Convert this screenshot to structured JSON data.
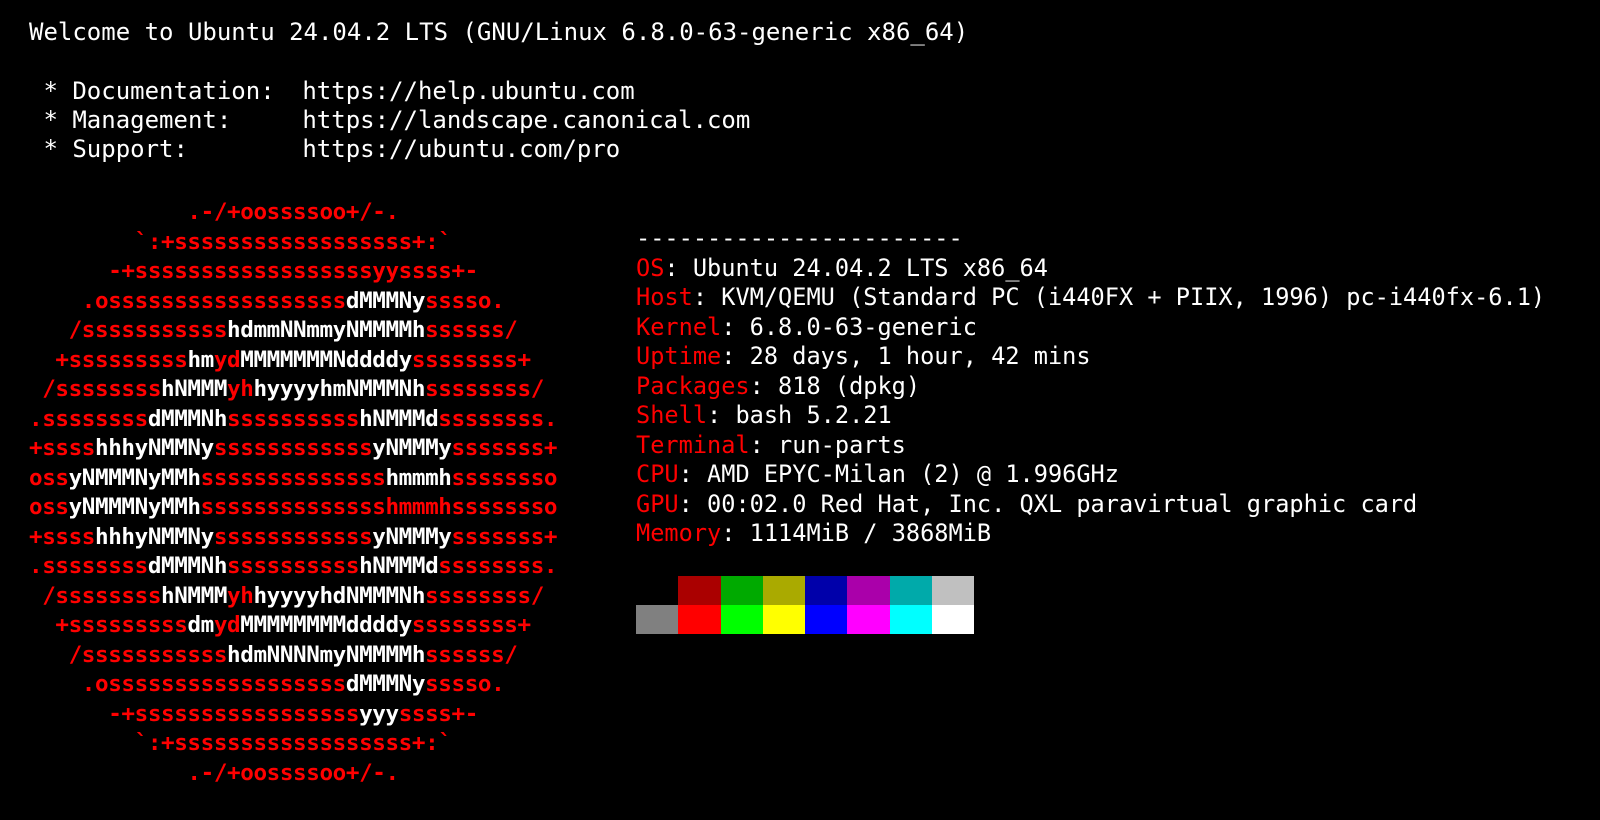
{
  "motd": {
    "welcome": "Welcome to Ubuntu 24.04.2 LTS (GNU/Linux 6.8.0-63-generic x86_64)",
    "links": [
      {
        "bullet": " * ",
        "label": "Documentation:",
        "url": "https://help.ubuntu.com"
      },
      {
        "bullet": " * ",
        "label": "Management:",
        "url": "https://landscape.canonical.com"
      },
      {
        "bullet": " * ",
        "label": "Support:",
        "url": "https://ubuntu.com/pro"
      }
    ]
  },
  "ascii_logo": [
    [
      [
        "r",
        "            .-/+oossssoo+/-."
      ]
    ],
    [
      [
        "r",
        "        `:+ssssssssssssssssss+:`"
      ]
    ],
    [
      [
        "r",
        "      -+ssssssssssssssssssyyssss+-"
      ]
    ],
    [
      [
        "r",
        "    .ossssssssssssssssss"
      ],
      [
        "w",
        "dMMMNy"
      ],
      [
        "r",
        "sssso."
      ]
    ],
    [
      [
        "r",
        "   /sssssssssss"
      ],
      [
        "w",
        "hdmmNNmmyNMMMMh"
      ],
      [
        "r",
        "ssssss/"
      ]
    ],
    [
      [
        "r",
        "  +sssssssss"
      ],
      [
        "w",
        "hm"
      ],
      [
        "r",
        "yd"
      ],
      [
        "w",
        "MMMMMMMNddddy"
      ],
      [
        "r",
        "ssssssss+"
      ]
    ],
    [
      [
        "r",
        " /ssssssss"
      ],
      [
        "w",
        "hNMMM"
      ],
      [
        "r",
        "yh"
      ],
      [
        "w",
        "hyyyyhmNMMMNh"
      ],
      [
        "r",
        "ssssssss/"
      ]
    ],
    [
      [
        "r",
        ".ssssssss"
      ],
      [
        "w",
        "dMMMNh"
      ],
      [
        "r",
        "ssssssssss"
      ],
      [
        "w",
        "hNMMMd"
      ],
      [
        "r",
        "ssssssss."
      ]
    ],
    [
      [
        "r",
        "+ssss"
      ],
      [
        "w",
        "hhhyNMMNy"
      ],
      [
        "r",
        "ssssssssssss"
      ],
      [
        "w",
        "yNMMMy"
      ],
      [
        "r",
        "sssssss+"
      ]
    ],
    [
      [
        "r",
        "oss"
      ],
      [
        "w",
        "yNMMMNyMMh"
      ],
      [
        "r",
        "ssssssssssssss"
      ],
      [
        "w",
        "hmmmh"
      ],
      [
        "r",
        "ssssssso"
      ]
    ],
    [
      [
        "r",
        "oss"
      ],
      [
        "w",
        "yNMMMNyMMh"
      ],
      [
        "r",
        "sssssssssssssshmmmhssssssso"
      ]
    ],
    [
      [
        "r",
        "+ssss"
      ],
      [
        "w",
        "hhhyNMMNy"
      ],
      [
        "r",
        "ssssssssssss"
      ],
      [
        "w",
        "yNMMMy"
      ],
      [
        "r",
        "sssssss+"
      ]
    ],
    [
      [
        "r",
        ".ssssssss"
      ],
      [
        "w",
        "dMMMNh"
      ],
      [
        "r",
        "ssssssssss"
      ],
      [
        "w",
        "hNMMMd"
      ],
      [
        "r",
        "ssssssss."
      ]
    ],
    [
      [
        "r",
        " /ssssssss"
      ],
      [
        "w",
        "hNMMM"
      ],
      [
        "r",
        "yh"
      ],
      [
        "w",
        "hyyyyhdNMMMNh"
      ],
      [
        "r",
        "ssssssss/"
      ]
    ],
    [
      [
        "r",
        "  +sssssssss"
      ],
      [
        "w",
        "dm"
      ],
      [
        "r",
        "yd"
      ],
      [
        "w",
        "MMMMMMMMddddy"
      ],
      [
        "r",
        "ssssssss+"
      ]
    ],
    [
      [
        "r",
        "   /sssssssssss"
      ],
      [
        "w",
        "hdmNNNNmyNMMMMh"
      ],
      [
        "r",
        "ssssss/"
      ]
    ],
    [
      [
        "r",
        "    .ossssssssssssssssss"
      ],
      [
        "w",
        "dMMMNy"
      ],
      [
        "r",
        "sssso."
      ]
    ],
    [
      [
        "r",
        "      -+sssssssssssssssss"
      ],
      [
        "w",
        "yyy"
      ],
      [
        "r",
        "ssss+-"
      ]
    ],
    [
      [
        "r",
        "        `:+ssssssssssssssssss+:`"
      ]
    ],
    [
      [
        "r",
        "            .-/+oossssoo+/-."
      ]
    ]
  ],
  "sysinfo": {
    "separator": "-----------------------",
    "entries": [
      {
        "key": "OS",
        "value": ": Ubuntu 24.04.2 LTS x86_64"
      },
      {
        "key": "Host",
        "value": ": KVM/QEMU (Standard PC (i440FX + PIIX, 1996) pc-i440fx-6.1)"
      },
      {
        "key": "Kernel",
        "value": ": 6.8.0-63-generic"
      },
      {
        "key": "Uptime",
        "value": ": 28 days, 1 hour, 42 mins"
      },
      {
        "key": "Packages",
        "value": ": 818 (dpkg)"
      },
      {
        "key": "Shell",
        "value": ": bash 5.2.21"
      },
      {
        "key": "Terminal",
        "value": ": run-parts"
      },
      {
        "key": "CPU",
        "value": ": AMD EPYC-Milan (2) @ 1.996GHz"
      },
      {
        "key": "GPU",
        "value": ": 00:02.0 Red Hat, Inc. QXL paravirtual graphic card"
      },
      {
        "key": "Memory",
        "value": ": 1114MiB / 3868MiB"
      }
    ]
  },
  "colors": {
    "background": "#000000",
    "foreground": "#ffffff",
    "accent_red": "#ff0000"
  },
  "palette": {
    "normal": [
      "#000000",
      "#aa0000",
      "#00aa00",
      "#aaaa00",
      "#0000aa",
      "#aa00aa",
      "#00aaaa",
      "#c0c0c0"
    ],
    "bright": [
      "#808080",
      "#ff0000",
      "#00ff00",
      "#ffff00",
      "#0000ff",
      "#ff00ff",
      "#00ffff",
      "#ffffff"
    ]
  }
}
